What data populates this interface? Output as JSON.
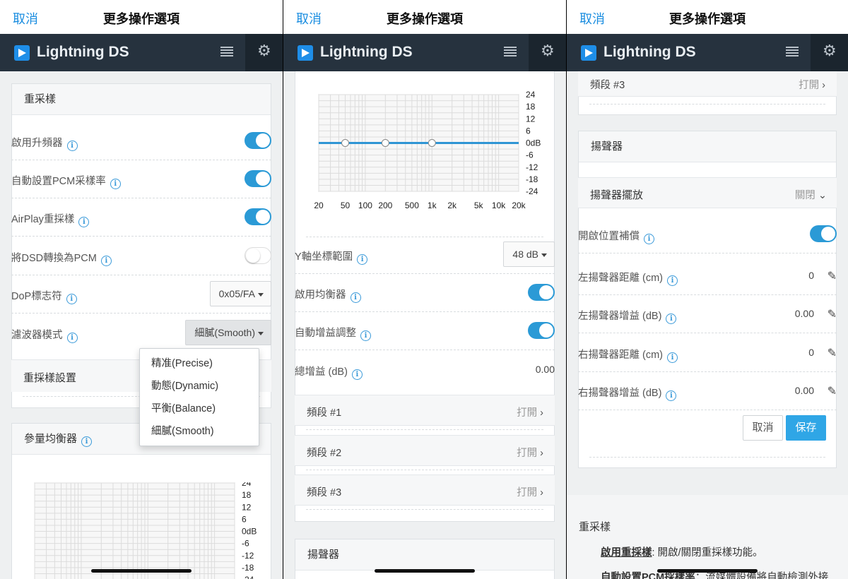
{
  "header": {
    "cancel": "取消",
    "title": "更多操作選項"
  },
  "app": {
    "name": "Lightning DS",
    "accent": "#1e8ee8",
    "bar_color": "#26323e"
  },
  "icons": {
    "menu": "menu-icon",
    "gear": "gear-icon",
    "info": "info-icon",
    "chevron": "chevron-right-icon",
    "edit": "edit-icon"
  },
  "panel1": {
    "resample_title": "重采樣",
    "rows": [
      {
        "label": "啟用升頻器",
        "type": "toggle",
        "on": true
      },
      {
        "label": "自動設置PCM采樣率",
        "type": "toggle",
        "on": true
      },
      {
        "label": "AirPlay重採樣",
        "type": "toggle",
        "on": true
      },
      {
        "label": "將DSD轉換為PCM",
        "type": "toggle",
        "on": false
      },
      {
        "label": "DoP標志符",
        "type": "select",
        "value": "0x05/FA"
      },
      {
        "label": "濾波器模式",
        "type": "select",
        "value": "細膩(Smooth)"
      }
    ],
    "dropdown_options": [
      "精准(Precise)",
      "動態(Dynamic)",
      "平衡(Balance)",
      "細膩(Smooth)"
    ],
    "resample_settings_title": "重採樣設置",
    "peq_title": "參量均衡器",
    "y_ticks": [
      "24",
      "18",
      "12",
      "6",
      "0dB",
      "-6",
      "-12",
      "-18",
      "-24"
    ]
  },
  "panel2": {
    "chart_data": {
      "type": "line",
      "title": "",
      "xlabel": "",
      "ylabel": "",
      "x_scale": "log",
      "x_ticks": [
        "20",
        "50",
        "100",
        "200",
        "500",
        "1k",
        "2k",
        "5k",
        "10k",
        "20k"
      ],
      "y_ticks": [
        "24",
        "18",
        "12",
        "6",
        "0dB",
        "-6",
        "-12",
        "-18",
        "-24"
      ],
      "ylim": [
        -24,
        24
      ],
      "xlim": [
        20,
        20000
      ],
      "series": [
        {
          "x": [
            20,
            20000
          ],
          "values": [
            0,
            0
          ]
        }
      ],
      "points": [
        {
          "x": 50,
          "y": 0
        },
        {
          "x": 200,
          "y": 0
        },
        {
          "x": 1000,
          "y": 0
        }
      ],
      "line_color": "#2f95d4",
      "grid": true
    },
    "rows": [
      {
        "label": "Y軸坐標範圍",
        "type": "select",
        "value": "48 dB"
      },
      {
        "label": "啟用均衡器",
        "type": "toggle",
        "on": true
      },
      {
        "label": "自動增益調整",
        "type": "toggle",
        "on": true
      },
      {
        "label": "總增益 (dB)",
        "type": "value",
        "value": "0.00"
      }
    ],
    "bands": [
      {
        "label": "頻段 #1",
        "state": "打開"
      },
      {
        "label": "頻段 #2",
        "state": "打開"
      },
      {
        "label": "頻段 #3",
        "state": "打開"
      }
    ],
    "speaker_title": "揚聲器"
  },
  "panel3": {
    "band3": {
      "label": "頻段 #3",
      "state": "打開"
    },
    "speaker_title": "揚聲器",
    "placement_title": "揚聲器擺放",
    "placement_state": "關閉",
    "rows": [
      {
        "label": "開啟位置補償",
        "type": "toggle",
        "on": true
      },
      {
        "label": "左揚聲器距離 (cm)",
        "type": "edit",
        "value": "0"
      },
      {
        "label": "左揚聲器增益 (dB)",
        "type": "edit",
        "value": "0.00"
      },
      {
        "label": "右揚聲器距離 (cm)",
        "type": "edit",
        "value": "0"
      },
      {
        "label": "右揚聲器增益 (dB)",
        "type": "edit",
        "value": "0.00"
      }
    ],
    "cancel_btn": "取消",
    "save_btn": "保存",
    "help": {
      "title": "重采樣",
      "item1_term": "啟用重採樣",
      "item1_desc": ": 開啟/關閉重採樣功能。",
      "item2_term": "自動設置PCM採樣率",
      "item2_desc": "：流媒體設備將自動檢測外接"
    }
  }
}
